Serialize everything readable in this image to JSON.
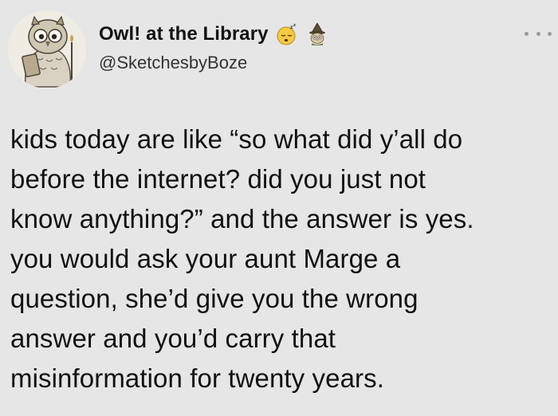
{
  "author": {
    "display_name": "Owl! at the Library",
    "handle": "@SketchesbyBoze",
    "avatar_icon": "owl-reading-book-avatar",
    "badges": [
      "sleeping-face-emoji",
      "owl-wizard-emoji"
    ]
  },
  "menu": {
    "icon": "more-options-icon"
  },
  "tweet": {
    "lines": [
      "kids today are like “so what did y’all do",
      "before the internet? did you just not",
      "know anything?” and the answer is yes.",
      "you would ask your aunt Marge a",
      "question, she’d give you the wrong",
      "answer and you’d carry that",
      "misinformation for twenty years."
    ]
  },
  "colors": {
    "background": "#e6e6e6",
    "text": "#111111",
    "handle": "#333333",
    "dots": "#9a9a9a"
  }
}
